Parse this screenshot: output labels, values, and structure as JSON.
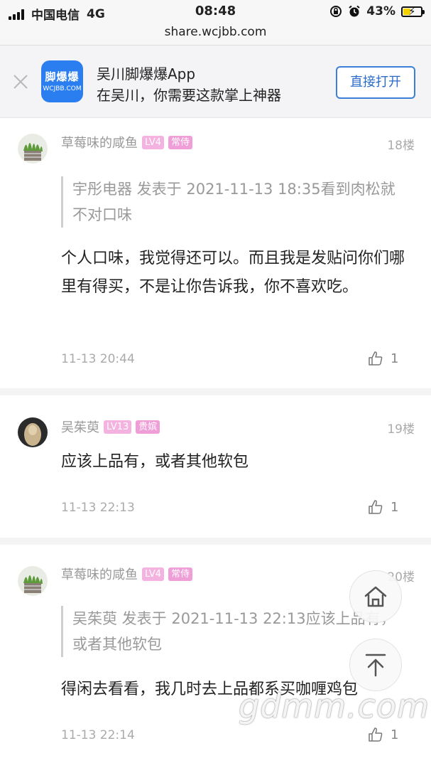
{
  "status_bar": {
    "carrier": "中国电信",
    "network": "4G",
    "time": "08:48",
    "battery_pct": "43%",
    "battery_level": 0.43
  },
  "url": "share.wcjbb.com",
  "banner": {
    "logo_text": "脚爆爆",
    "logo_sub": "WCJBB.COM",
    "title": "吴川脚爆爆App",
    "subtitle": "在吴川，你需要这款掌上神器",
    "open_button": "直接打开"
  },
  "posts": [
    {
      "user": "草莓味的咸鱼",
      "level": "LV4",
      "title": "常侍",
      "floor": "18楼",
      "quote": "宇彤电器 发表于 2021-11-13 18:35看到肉松就不对口味",
      "content": "个人口味，我觉得还可以。而且我是发贴问你们哪里有得买，不是让你告诉我，你不喜欢吃。",
      "time": "11-13 20:44",
      "likes": "1"
    },
    {
      "user": "吴茱萸",
      "level": "LV13",
      "title": "贵嫔",
      "floor": "19楼",
      "content": "应该上品有，或者其他软包",
      "time": "11-13 22:13",
      "likes": "1"
    },
    {
      "user": "草莓味的咸鱼",
      "level": "LV4",
      "title": "常侍",
      "floor": "20楼",
      "quote": "吴茱萸 发表于 2021-11-13 22:13应该上品有，或者其他软包",
      "content": "得闲去看看，我几时去上品都系买咖喱鸡包",
      "time": "11-13 22:14",
      "likes": "1"
    }
  ],
  "watermark": "gdmm.com",
  "colors": {
    "accent_blue": "#3b7fd6",
    "badge_pink": "#f3b2e0",
    "logo_blue": "#2a7ef0"
  }
}
